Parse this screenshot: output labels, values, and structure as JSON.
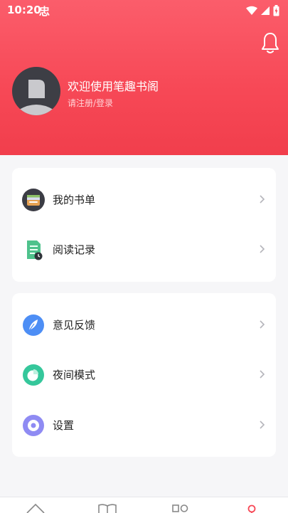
{
  "status_bar": {
    "time": "10:20",
    "app_glyph": "忠",
    "icons": [
      "wifi-icon",
      "signal-icon",
      "battery-icon"
    ]
  },
  "header": {
    "welcome_text": "欢迎使用笔趣书阁",
    "login_text": "请注册/登录",
    "bell_icon": "bell-icon"
  },
  "menu_group_1": [
    {
      "label": "我的书单",
      "icon": "booklist-icon"
    },
    {
      "label": "阅读记录",
      "icon": "reading-record-icon"
    }
  ],
  "menu_group_2": [
    {
      "label": "意见反馈",
      "icon": "feedback-icon"
    },
    {
      "label": "夜间模式",
      "icon": "night-mode-icon"
    },
    {
      "label": "设置",
      "icon": "settings-icon"
    }
  ],
  "bottom_nav": [
    "home-icon",
    "bookshelf-icon",
    "category-icon",
    "profile-icon"
  ],
  "colors": {
    "accent": "#f74957",
    "feedback": "#4d8ef5",
    "night": "#35c79b",
    "settings": "#8f8bf3"
  }
}
